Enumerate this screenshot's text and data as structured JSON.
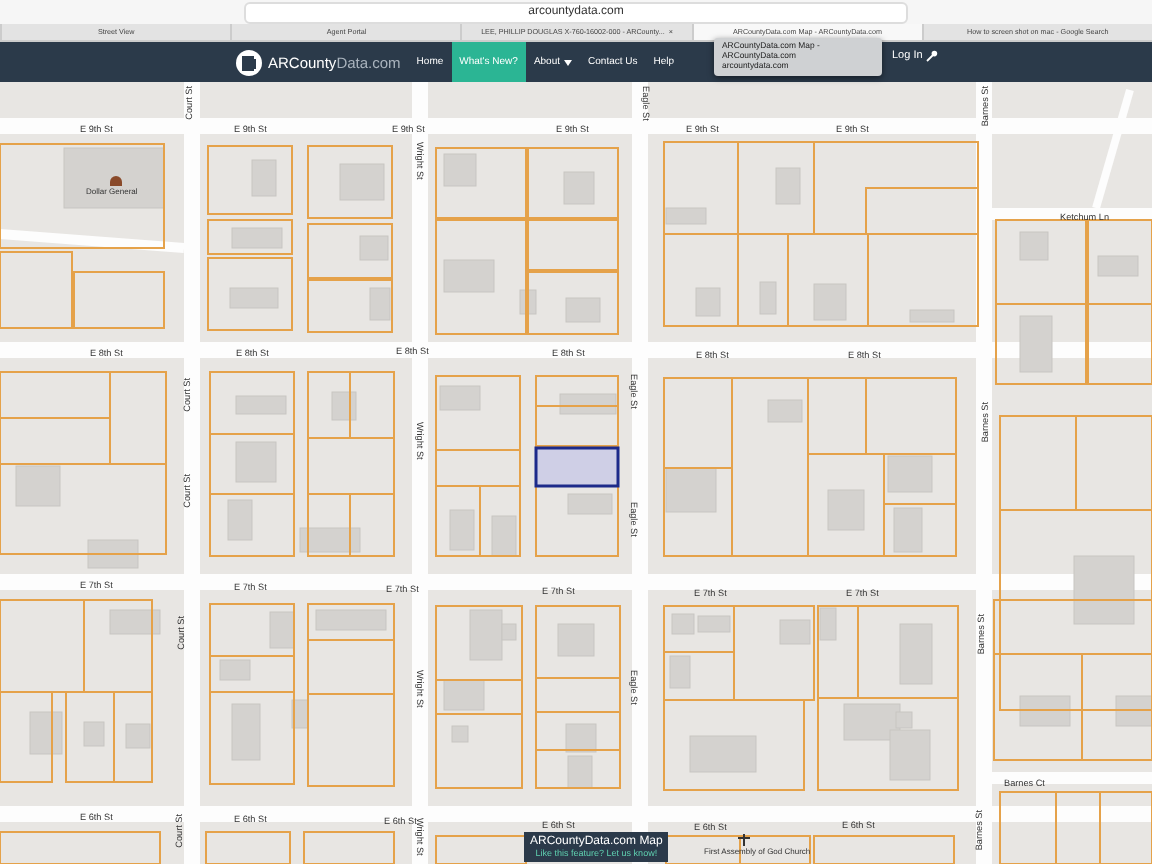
{
  "browser": {
    "address": "arcountydata.com",
    "tabs": [
      {
        "title": "Street View",
        "selected": false
      },
      {
        "title": "Agent Portal",
        "selected": false
      },
      {
        "title": "LEE, PHILLIP DOUGLAS X-760-16002-000 - ARCounty...",
        "selected": false,
        "close": "×"
      },
      {
        "title": "ARCountyData.com Map - ARCountyData.com",
        "selected": true
      },
      {
        "title": "How to screen shot on mac - Google Search",
        "selected": false
      }
    ]
  },
  "navbar": {
    "logo_main": "ARCounty",
    "logo_sub": "Data.com",
    "items": [
      {
        "label": "Home",
        "selected": false
      },
      {
        "label": "What's New?",
        "selected": true
      },
      {
        "label": "About",
        "selected": false,
        "dropdown": true
      },
      {
        "label": "Contact Us",
        "selected": false
      },
      {
        "label": "Help",
        "selected": false
      }
    ],
    "login": "Log In"
  },
  "tab_tooltip": {
    "title": "ARCountyData.com Map - ARCountyData.com",
    "url": "arcountydata.com"
  },
  "map_labels": [
    {
      "text": "E 9th St",
      "kind": "street"
    },
    {
      "text": "E 9th St",
      "kind": "street"
    },
    {
      "text": "E 9th St",
      "kind": "street"
    },
    {
      "text": "E 9th St",
      "kind": "street"
    },
    {
      "text": "E 9th St",
      "kind": "street"
    },
    {
      "text": "E 9th St",
      "kind": "street"
    },
    {
      "text": "Court St",
      "kind": "street"
    },
    {
      "text": "Wright St",
      "kind": "street"
    },
    {
      "text": "Eagle St",
      "kind": "street"
    },
    {
      "text": "Barnes St",
      "kind": "street"
    },
    {
      "text": "Dollar General",
      "kind": "place"
    },
    {
      "text": "Ketchum Ln",
      "kind": "street"
    },
    {
      "text": "E 8th St",
      "kind": "street"
    },
    {
      "text": "E 8th St",
      "kind": "street"
    },
    {
      "text": "E 8th St",
      "kind": "street"
    },
    {
      "text": "E 8th St",
      "kind": "street"
    },
    {
      "text": "E 8th St",
      "kind": "street"
    },
    {
      "text": "E 8th St",
      "kind": "street"
    },
    {
      "text": "Court St",
      "kind": "street"
    },
    {
      "text": "Eagle St",
      "kind": "street"
    },
    {
      "text": "Barnes St",
      "kind": "street"
    },
    {
      "text": "Court St",
      "kind": "street"
    },
    {
      "text": "Wright St",
      "kind": "street"
    },
    {
      "text": "Eagle St",
      "kind": "street"
    },
    {
      "text": "E 7th St",
      "kind": "street"
    },
    {
      "text": "E 7th St",
      "kind": "street"
    },
    {
      "text": "E 7th St",
      "kind": "street"
    },
    {
      "text": "E 7th St",
      "kind": "street"
    },
    {
      "text": "E 7th St",
      "kind": "street"
    },
    {
      "text": "E 7th St",
      "kind": "street"
    },
    {
      "text": "Court St",
      "kind": "street"
    },
    {
      "text": "Wright St",
      "kind": "street"
    },
    {
      "text": "Eagle St",
      "kind": "street"
    },
    {
      "text": "Barnes St",
      "kind": "street"
    },
    {
      "text": "Barnes Ct",
      "kind": "street"
    },
    {
      "text": "E 6th St",
      "kind": "street"
    },
    {
      "text": "E 6th St",
      "kind": "street"
    },
    {
      "text": "E 6th St",
      "kind": "street"
    },
    {
      "text": "E 6th St",
      "kind": "street"
    },
    {
      "text": "E 6th St",
      "kind": "street"
    },
    {
      "text": "E 6th St",
      "kind": "street"
    },
    {
      "text": "Court St",
      "kind": "street"
    },
    {
      "text": "Wright St",
      "kind": "street"
    },
    {
      "text": "Barnes St",
      "kind": "street"
    },
    {
      "text": "First Assembly of God Church",
      "kind": "place"
    }
  ],
  "map_popup": {
    "title": "ARCountyData.com Map",
    "link": "Like this feature? Let us know!"
  }
}
